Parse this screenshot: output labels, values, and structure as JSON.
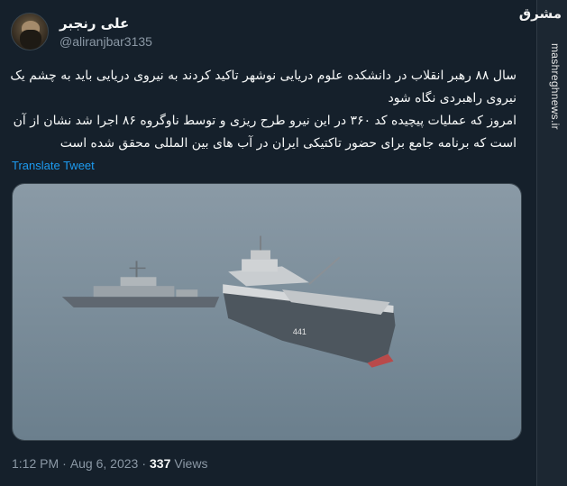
{
  "author": {
    "display_name": "علی رنجبر",
    "handle": "@aliranjbar3135"
  },
  "tweet": {
    "line1": "سال ۸۸ رهبر انقلاب در دانشکده علوم دریایی نوشهر تاکید کردند به نیروی دریایی باید به چشم یک نیروی راهبردی نگاه شود",
    "line2": "امروز که عملیات پیچیده کد ۳۶۰ در این نیرو طرح ریزی و توسط ناوگروه ۸۶ اجرا شد نشان از آن است که برنامه جامع برای حضور تاکتیکی ایران در آب های بین المللی محقق شده است",
    "translate_label": "Translate Tweet"
  },
  "media": {
    "description_icon": "photo-ships",
    "hull_number": "441"
  },
  "meta": {
    "time": "1:12 PM",
    "separator": "·",
    "date": "Aug 6, 2023",
    "views_count": "337",
    "views_label": "Views"
  },
  "watermark": {
    "logo": "مشرق",
    "url": "mashreghnews.ir"
  },
  "colors": {
    "background": "#15202b",
    "link": "#1d9bf0",
    "secondary_text": "#8b98a5"
  }
}
